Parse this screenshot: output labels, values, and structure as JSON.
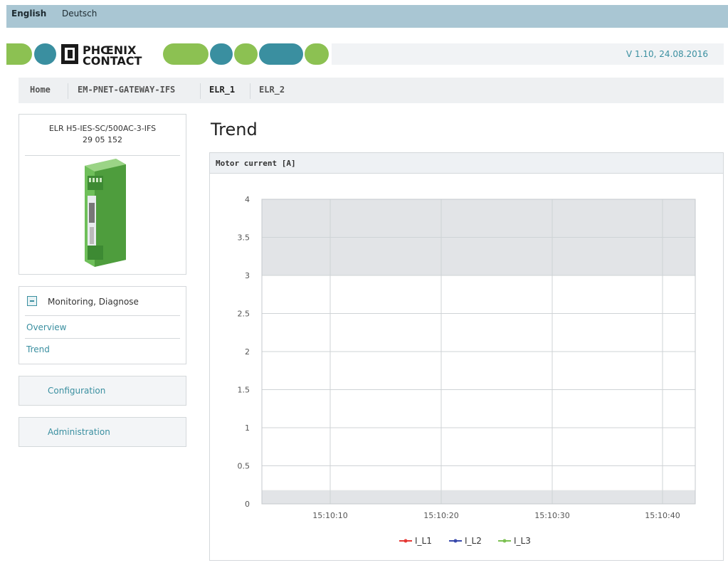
{
  "language_bar": {
    "english": "English",
    "deutsch": "Deutsch"
  },
  "header": {
    "logo_line1": "PHŒNIX",
    "logo_line2": "CONTACT",
    "version": "V 1.10, 24.08.2016"
  },
  "nav": {
    "items": [
      {
        "label": "Home"
      },
      {
        "label": "EM-PNET-GATEWAY-IFS"
      },
      {
        "label": "ELR_1",
        "active": true
      },
      {
        "label": "ELR_2"
      }
    ]
  },
  "product": {
    "name": "ELR H5-IES-SC/500AC-3-IFS",
    "number": "29 05 152"
  },
  "sidebar": {
    "section_title": "Monitoring, Diagnose",
    "links": [
      {
        "label": "Overview"
      },
      {
        "label": "Trend"
      }
    ],
    "configuration": "Configuration",
    "administration": "Administration"
  },
  "page": {
    "title": "Trend"
  },
  "panel": {
    "title": "Motor current [A]"
  },
  "colors": {
    "accent": "#3a8fa0",
    "logo_teal": "#3a8fa0",
    "logo_green": "#8cc152",
    "band_gray": "#e2e4e7"
  },
  "chart_data": {
    "type": "line",
    "ylim": [
      0,
      4
    ],
    "yticks": [
      "0",
      "0.5",
      "1",
      "1.5",
      "2",
      "2.5",
      "3",
      "3.5",
      "4"
    ],
    "xticks": [
      "15:10:10",
      "15:10:20",
      "15:10:30",
      "15:10:40"
    ],
    "bands": [
      {
        "from": 3,
        "to": 4,
        "color": "#e2e4e7"
      },
      {
        "from": 0,
        "to": 0.18,
        "color": "#e2e4e7"
      }
    ],
    "series": [
      {
        "name": "I_L1",
        "color": "#e53935",
        "values": []
      },
      {
        "name": "I_L2",
        "color": "#3949ab",
        "values": []
      },
      {
        "name": "I_L3",
        "color": "#7cc152",
        "values": []
      }
    ],
    "grid": true,
    "legend": "bottom-center"
  }
}
